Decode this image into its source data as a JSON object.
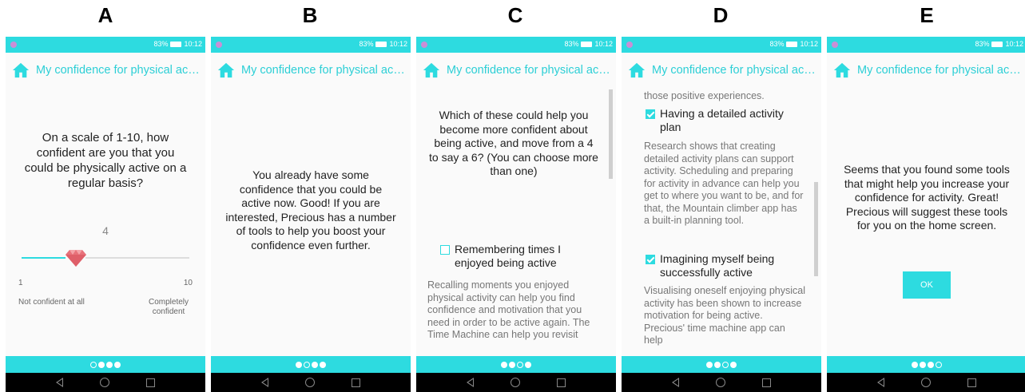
{
  "panel_letters": [
    "A",
    "B",
    "C",
    "D",
    "E"
  ],
  "status": {
    "battery": "83%",
    "time": "10:12"
  },
  "app_title": "My confidence for physical acti...",
  "panelA": {
    "question": "On a scale of 1-10, how confident are you that you could be physically active on a regular basis?",
    "slider_value": "4",
    "slider_fraction": 0.333,
    "scale_min": "1",
    "scale_max": "10",
    "label_min": "Not confident at all",
    "label_max": "Completely confident",
    "page_dots": "○●●●"
  },
  "panelB": {
    "text": "You already have some confidence that you could be active now. Good! If you are interested, Precious has a number of tools to help you boost your confidence even further.",
    "page_dots": "●○●●"
  },
  "panelC": {
    "question": "Which of these could help you become more confident about being active, and move from a 4 to say a 6? (You can choose more than one)",
    "option_label": "Remembering times I enjoyed being active",
    "option_checked": false,
    "option_desc": "Recalling moments you enjoyed physical activity can help you find confidence and motivation that you need in order to be active again. The Time Machine can help you revisit",
    "page_dots": "●●○●"
  },
  "panelD": {
    "top_text": "those positive experiences.",
    "option1_label": "Having a detailed activity plan",
    "option1_checked": true,
    "option1_desc": "Research shows that creating detailed activity plans can support activity. Scheduling and preparing for activity in advance can help you get to where you want to be, and for that, the Mountain climber app has a built-in planning tool.",
    "option2_label": "Imagining myself being successfully active",
    "option2_checked": true,
    "option2_desc": "Visualising oneself enjoying physical activity has been shown to increase motivation for being active. Precious' time machine app can help",
    "page_dots": "●●○●"
  },
  "panelE": {
    "text": "Seems that you found some tools that might help you increase your confidence for activity. Great! Precious will suggest these tools for you on the home screen.",
    "ok_label": "OK",
    "page_dots": "●●●○"
  },
  "colors": {
    "accent": "#2ddbe0",
    "title": "#2ccfd6",
    "gem": "#e8727a"
  },
  "icons": [
    "home-icon",
    "back-nav-icon",
    "home-nav-icon",
    "recents-nav-icon",
    "gem-slider-thumb",
    "battery-icon"
  ]
}
